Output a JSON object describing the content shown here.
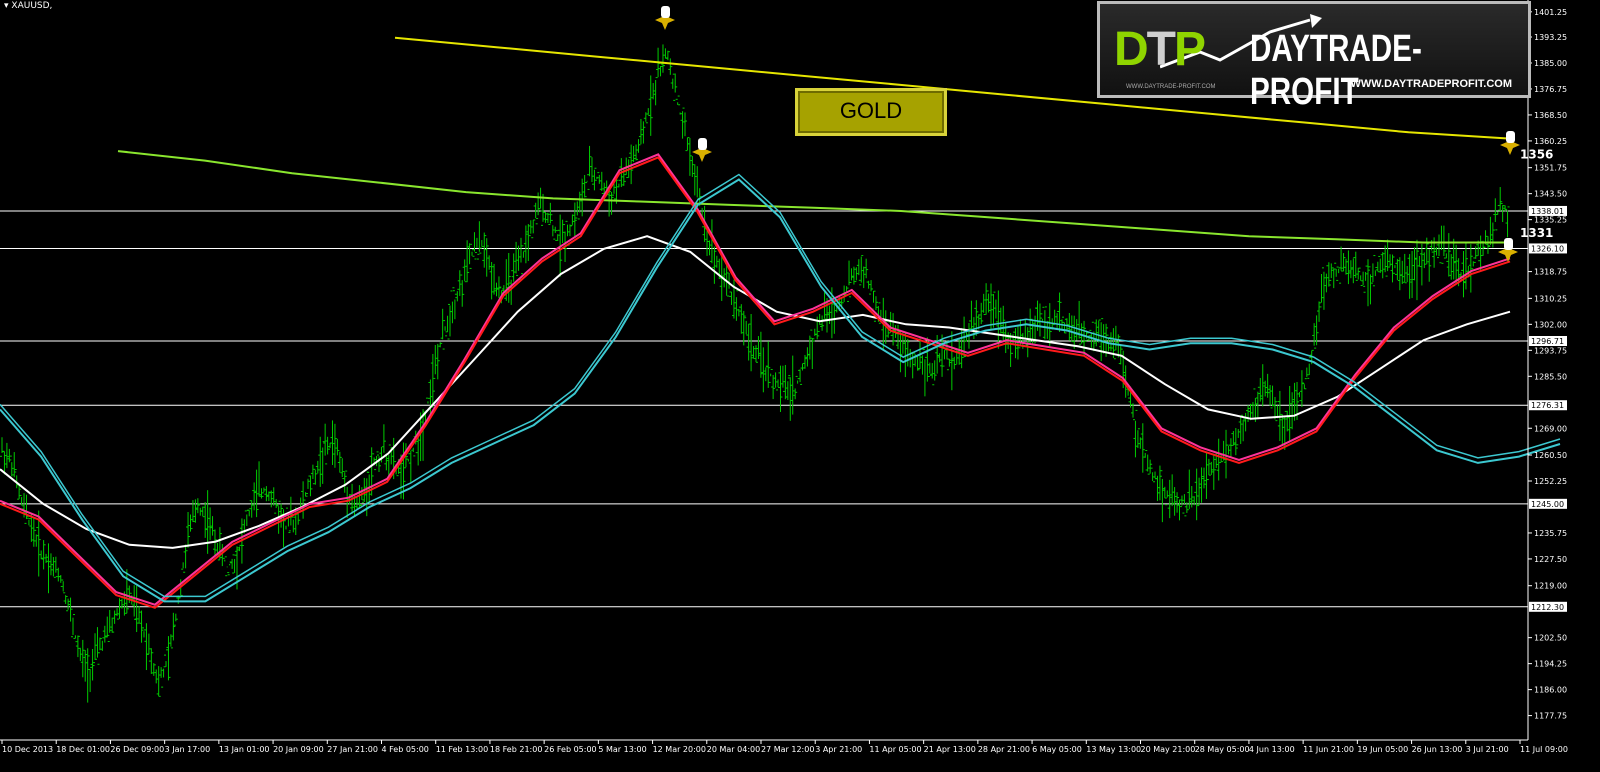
{
  "symbol": "XAUUSD,",
  "gold_label": "GOLD",
  "logo": {
    "brand": "DAYTRADE-PROFIT",
    "mark": [
      "D",
      "T",
      "P"
    ],
    "url": "WWW.DAYTRADEPROFIT.COM",
    "url_small": "WWW.DAYTRADE-PROFIT.COM"
  },
  "colors": {
    "background": "#000000",
    "candles": "#00cc00",
    "ma_yellow": "#e6e600",
    "ma_green": "#8ae62e",
    "ma_white": "#ffffff",
    "ma_red": "#ff1a1a",
    "ma_magenta": "#ff3399",
    "envelope": "#3cc8d0",
    "hline": "#ffffff",
    "gold_button": "#a6a200"
  },
  "chart_data": {
    "type": "line",
    "title": "",
    "ylim": [
      1170,
      1405
    ],
    "y_ticks": [
      "1401.25",
      "1393.25",
      "1385.00",
      "1376.75",
      "1368.50",
      "1360.25",
      "1351.75",
      "1343.50",
      "1335.25",
      "1318.75",
      "1310.25",
      "1302.00",
      "1293.75",
      "1285.50",
      "1269.00",
      "1260.50",
      "1252.25",
      "1235.75",
      "1227.50",
      "1219.00",
      "1202.50",
      "1194.25",
      "1186.00",
      "1177.75"
    ],
    "x_labels": [
      "10 Dec 2013",
      "18 Dec 01:00",
      "26 Dec 09:00",
      "3 Jan 17:00",
      "13 Jan 01:00",
      "20 Jan 09:00",
      "27 Jan 21:00",
      "4 Feb 05:00",
      "11 Feb 13:00",
      "18 Feb 21:00",
      "26 Feb 05:00",
      "5 Mar 13:00",
      "12 Mar 20:00",
      "20 Mar 04:00",
      "27 Mar 12:00",
      "3 Apr 21:00",
      "11 Apr 05:00",
      "21 Apr 13:00",
      "28 Apr 21:00",
      "6 May 05:00",
      "13 May 13:00",
      "20 May 21:00",
      "28 May 05:00",
      "4 Jun 13:00",
      "11 Jun 21:00",
      "19 Jun 05:00",
      "26 Jun 13:00",
      "3 Jul 21:00",
      "11 Jul 09:00"
    ],
    "horizontal_levels": [
      {
        "value": 1338.01,
        "label": "1338.01"
      },
      {
        "value": 1326.1,
        "label": "1326.10"
      },
      {
        "value": 1296.71,
        "label": "1296.71"
      },
      {
        "value": 1276.31,
        "label": "1276.31"
      },
      {
        "value": 1245.0,
        "label": "1245.00"
      },
      {
        "value": 1212.3,
        "label": "1212.30"
      }
    ],
    "annotations": [
      {
        "text": "1356",
        "value": 1356
      },
      {
        "text": "1331",
        "value": 1331
      }
    ],
    "price": [
      1262,
      1258,
      1245,
      1238,
      1230,
      1226,
      1222,
      1210,
      1196,
      1192,
      1200,
      1205,
      1212,
      1216,
      1208,
      1200,
      1188,
      1195,
      1215,
      1235,
      1245,
      1240,
      1232,
      1225,
      1228,
      1240,
      1248,
      1250,
      1244,
      1238,
      1240,
      1248,
      1255,
      1262,
      1265,
      1252,
      1244,
      1248,
      1258,
      1262,
      1257,
      1255,
      1262,
      1270,
      1285,
      1298,
      1308,
      1315,
      1325,
      1328,
      1318,
      1312,
      1316,
      1322,
      1332,
      1340,
      1335,
      1328,
      1333,
      1340,
      1350,
      1348,
      1342,
      1346,
      1352,
      1357,
      1370,
      1382,
      1388,
      1372,
      1360,
      1345,
      1330,
      1322,
      1316,
      1308,
      1300,
      1292,
      1288,
      1283,
      1282,
      1281,
      1290,
      1299,
      1305,
      1306,
      1312,
      1318,
      1320,
      1310,
      1302,
      1300,
      1294,
      1290,
      1292,
      1286,
      1292,
      1290,
      1294,
      1302,
      1305,
      1310,
      1304,
      1296,
      1296,
      1300,
      1304,
      1302,
      1304,
      1300,
      1299,
      1298,
      1300,
      1297,
      1296,
      1280,
      1266,
      1258,
      1252,
      1248,
      1246,
      1245,
      1248,
      1254,
      1258,
      1262,
      1266,
      1272,
      1278,
      1282,
      1276,
      1270,
      1276,
      1282,
      1296,
      1316,
      1318,
      1320,
      1320,
      1316,
      1318,
      1322,
      1320,
      1320,
      1318,
      1322,
      1326,
      1326,
      1322,
      1318,
      1320,
      1326,
      1330,
      1340,
      1336
    ],
    "series": [
      {
        "values": [
          1393,
          1390,
          1387,
          1384,
          1381,
          1378,
          1375,
          1372,
          1369,
          1366,
          1363,
          1361
        ]
      },
      {
        "values": [
          1357,
          1354,
          1350,
          1347,
          1344,
          1342,
          1341,
          1340,
          1339,
          1338,
          1336,
          1334,
          1332,
          1330,
          1329,
          1328,
          1328
        ]
      },
      {
        "values": [
          1256,
          1245,
          1237,
          1232,
          1231,
          1233,
          1238,
          1244,
          1251,
          1261,
          1276,
          1291,
          1306,
          1318,
          1326,
          1330,
          1325,
          1314,
          1306,
          1303,
          1305,
          1302,
          1301,
          1299,
          1297,
          1295,
          1292,
          1283,
          1275,
          1272,
          1273,
          1279,
          1288,
          1297,
          1302,
          1306
        ]
      },
      {
        "values": [
          1245,
          1240,
          1228,
          1216,
          1212,
          1222,
          1232,
          1238,
          1244,
          1246,
          1252,
          1270,
          1290,
          1311,
          1322,
          1330,
          1350,
          1355,
          1338,
          1316,
          1302,
          1306,
          1312,
          1300,
          1296,
          1292,
          1296,
          1294,
          1292,
          1284,
          1268,
          1262,
          1258,
          1262,
          1268,
          1285,
          1300,
          1310,
          1318,
          1322
        ]
      },
      {
        "values": [
          1275,
          1260,
          1240,
          1222,
          1214,
          1214,
          1222,
          1230,
          1236,
          1244,
          1250,
          1258,
          1264,
          1270,
          1280,
          1298,
          1320,
          1340,
          1348,
          1336,
          1314,
          1298,
          1290,
          1296,
          1300,
          1302,
          1300,
          1296,
          1294,
          1296,
          1296,
          1294,
          1290,
          1282,
          1272,
          1262,
          1258,
          1260,
          1264
        ]
      }
    ]
  }
}
